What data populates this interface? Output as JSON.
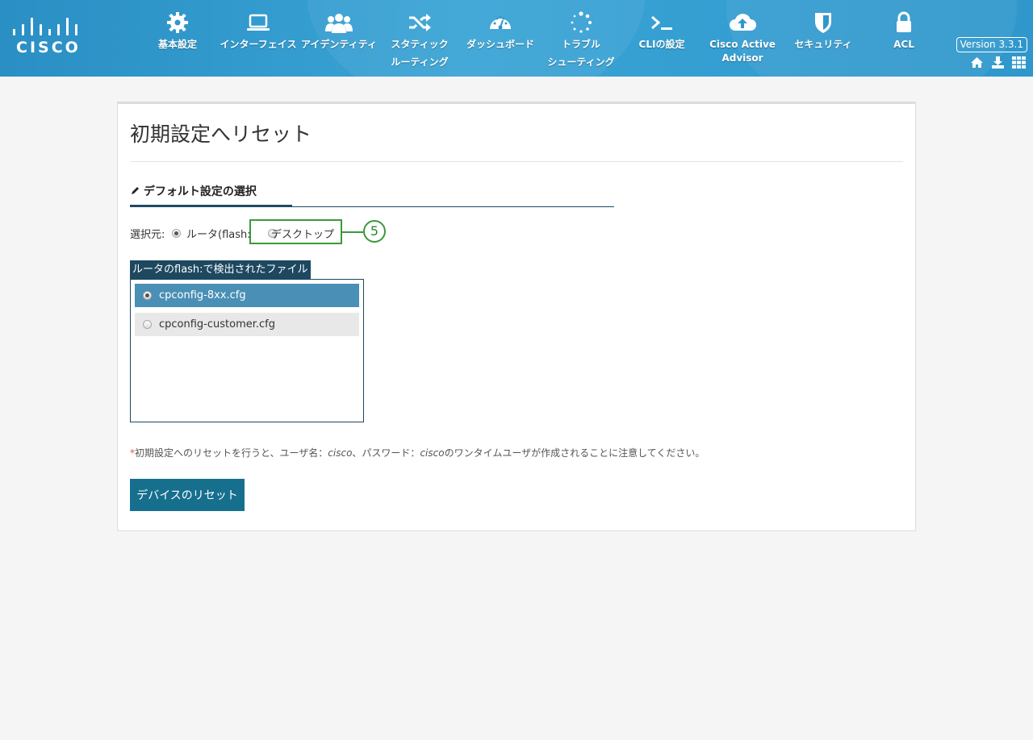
{
  "header": {
    "logo_text": "CISCO",
    "nav": [
      {
        "label": "基本設定",
        "icon": "gear-icon"
      },
      {
        "label": "インターフェイス",
        "icon": "laptop-icon"
      },
      {
        "label": "アイデンティティ",
        "icon": "users-icon"
      },
      {
        "label": "スタティック\nルーティング",
        "icon": "shuffle-icon"
      },
      {
        "label": "ダッシュボード",
        "icon": "gauge-icon"
      },
      {
        "label": "トラブル\nシューティング",
        "icon": "spinner-icon"
      },
      {
        "label": "CLIの設定",
        "icon": "terminal-icon"
      },
      {
        "label": "Cisco Active\nAdvisor",
        "icon": "cloud-upload-icon"
      },
      {
        "label": "セキュリティ",
        "icon": "shield-icon"
      },
      {
        "label": "ACL",
        "icon": "lock-icon"
      }
    ],
    "version": "Version 3.3.1",
    "right_icons": [
      "home-icon",
      "download-icon",
      "grid-icon"
    ]
  },
  "page": {
    "title": "初期設定へリセット",
    "section_heading": "デフォルト設定の選択",
    "source_label": "選択元:",
    "source_options": [
      {
        "label": "ルータ(flash:",
        "selected": true
      },
      {
        "label": "デスクトップ",
        "selected": false
      }
    ],
    "callout_number": "5",
    "files_label": "ルータのflash:で検出されたファイル",
    "files": [
      {
        "name": "cpconfig-8xx.cfg",
        "selected": true
      },
      {
        "name": "cpconfig-customer.cfg",
        "selected": false
      }
    ],
    "note": {
      "star": "*",
      "part1": "初期設定へのリセットを行うと、ユーザ名：",
      "username": "cisco",
      "part2": "、パスワード：",
      "password": "cisco",
      "part3": "のワンタイムユーザが作成されることに注意してください。"
    },
    "reset_button": "デバイスのリセット"
  },
  "colors": {
    "header": "#2f97cc",
    "selected_row": "#4a8fb5",
    "button": "#176f8e",
    "callout": "#3a9a3a"
  }
}
